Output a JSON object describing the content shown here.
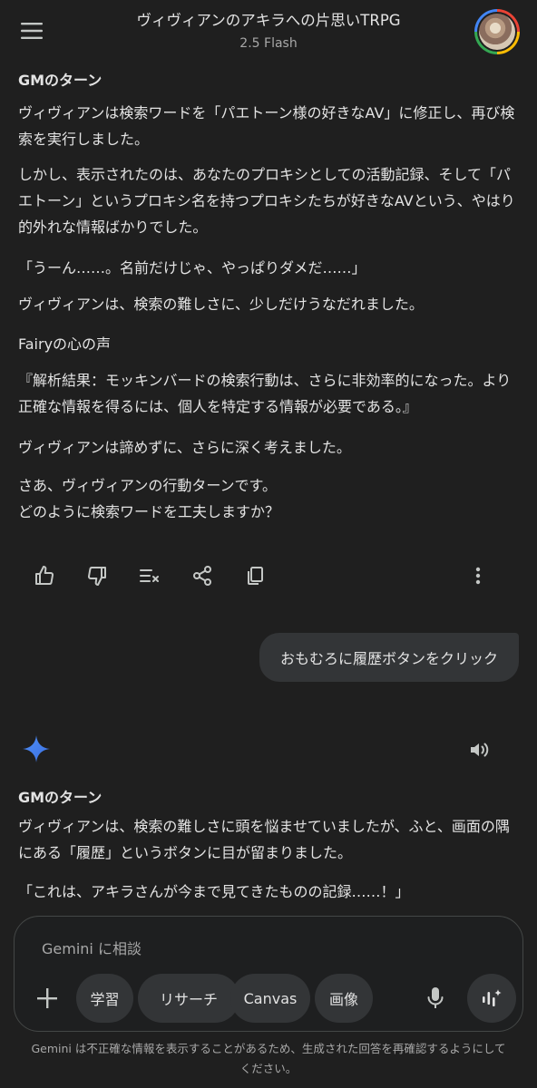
{
  "header": {
    "title": "ヴィヴィアンのアキラへの片思いTRPG",
    "subtitle": "2.5 Flash",
    "menu_icon": "hamburger-menu-icon",
    "avatar_icon": "user-avatar"
  },
  "response1": {
    "heading": "GMのターン",
    "p1": "ヴィヴィアンは検索ワードを「パエトーン様の好きなAV」に修正し、再び検索を実行しました。",
    "p2": "しかし、表示されたのは、あなたのプロキシとしての活動記録、そして「パエトーン」というプロキシ名を持つプロキシたちが好きなAVという、やはり的外れな情報ばかりでした。",
    "p3": "「うーん……。名前だけじゃ、やっぱりダメだ……」",
    "p4": "ヴィヴィアンは、検索の難しさに、少しだけうなだれました。",
    "fairy_heading": "Fairyの心の声",
    "p5": "『解析結果：モッキンバードの検索行動は、さらに非効率的になった。より正確な情報を得るには、個人を特定する情報が必要である。』",
    "p6": "ヴィヴィアンは諦めずに、さらに深く考えました。",
    "p7_line1": "さあ、ヴィヴィアンの行動ターンです。",
    "p7_line2": "どのように検索ワードを工夫しますか？"
  },
  "actions": [
    "thumbs-up-icon",
    "thumbs-down-icon",
    "double-check-icon",
    "share-icon",
    "copy-icon",
    "more-vert-icon"
  ],
  "user_message": "おもむろに履歴ボタンをクリック",
  "response2": {
    "heading": "GMのターン",
    "p1": "ヴィヴィアンは、検索の難しさに頭を悩ませていましたが、ふと、画面の隅にある「履歴」というボタンに目が留まりました。",
    "p2": "「これは、アキラさんが今まで見てきたものの記録……！」"
  },
  "input": {
    "placeholder": "Gemini に相談",
    "chips": [
      "学習",
      "リサーチ",
      "Canvas",
      "画像"
    ]
  },
  "disclaimer": "Gemini は不正確な情報を表示することがあるため、生成された回答を再確認するようにしてください。",
  "colors": {
    "background": "#1f1f1f",
    "bubble": "#333537",
    "text": "#e3e3e3",
    "muted": "#a8a8a8",
    "sparkle": "#4285f4"
  }
}
